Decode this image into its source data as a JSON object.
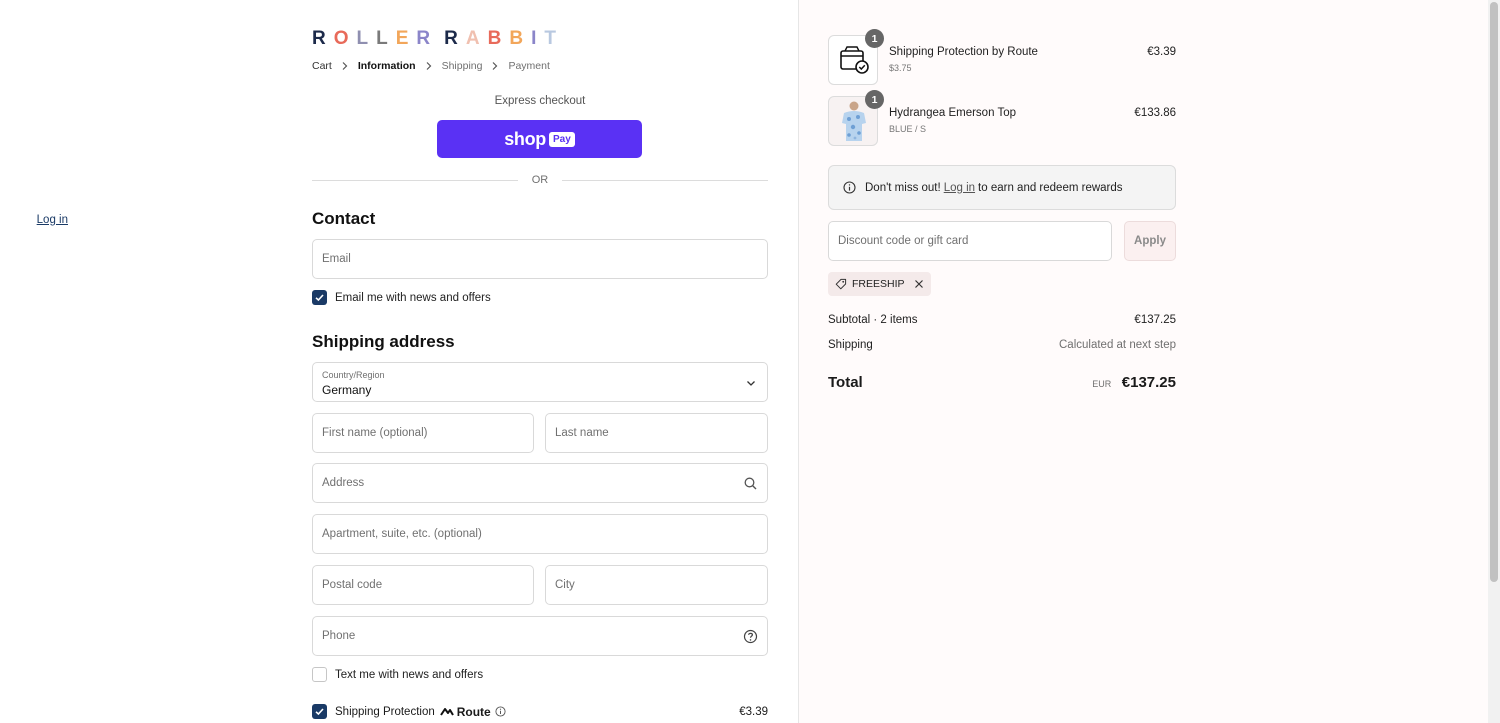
{
  "brand": {
    "logo_letters": [
      {
        "ch": "R",
        "color": "#1c2a4a"
      },
      {
        "ch": "O",
        "color": "#e86a5a"
      },
      {
        "ch": "L",
        "color": "#8f8fb0"
      },
      {
        "ch": "L",
        "color": "#7a7a7a"
      },
      {
        "ch": "E",
        "color": "#f2a65a"
      },
      {
        "ch": "R",
        "color": "#8b85c9"
      },
      {
        "ch": "R",
        "color": "#1c2a4a"
      },
      {
        "ch": "A",
        "color": "#f0c0b0"
      },
      {
        "ch": "B",
        "color": "#e86a5a"
      },
      {
        "ch": "B",
        "color": "#f2a65a"
      },
      {
        "ch": "I",
        "color": "#8b85c9"
      },
      {
        "ch": "T",
        "color": "#b8c8e0"
      }
    ]
  },
  "breadcrumb": {
    "cart": "Cart",
    "information": "Information",
    "shipping": "Shipping",
    "payment": "Payment"
  },
  "express": {
    "label": "Express checkout",
    "shop_label": "shop",
    "pay_label": "Pay",
    "or": "OR"
  },
  "contact": {
    "heading": "Contact",
    "login": "Log in",
    "email_placeholder": "Email",
    "email_news": "Email me with news and offers"
  },
  "shipping": {
    "heading": "Shipping address",
    "country_label": "Country/Region",
    "country_value": "Germany",
    "first_name_placeholder": "First name (optional)",
    "last_name_placeholder": "Last name",
    "address_placeholder": "Address",
    "apartment_placeholder": "Apartment, suite, etc. (optional)",
    "postal_placeholder": "Postal code",
    "city_placeholder": "City",
    "phone_placeholder": "Phone",
    "text_news": "Text me with news and offers",
    "protection_label": "Shipping Protection",
    "route_label": "Route",
    "protection_price": "€3.39"
  },
  "order": {
    "items": [
      {
        "name": "Shipping Protection by Route",
        "sub": "$3.75",
        "price": "€3.39",
        "qty": "1"
      },
      {
        "name": "Hydrangea Emerson Top",
        "sub": "BLUE / S",
        "price": "€133.86",
        "qty": "1"
      }
    ],
    "rewards": {
      "prefix": "Don't miss out!",
      "link": "Log in",
      "suffix": "to earn and redeem rewards"
    },
    "discount_placeholder": "Discount code or gift card",
    "apply": "Apply",
    "tag": "FREESHIP",
    "subtotal_label": "Subtotal · 2 items",
    "subtotal_value": "€137.25",
    "shipping_label": "Shipping",
    "shipping_value": "Calculated at next step",
    "total_label": "Total",
    "total_currency": "EUR",
    "total_value": "€137.25"
  },
  "colors": {
    "accent": "#1a3a66",
    "shoppay": "#5a31f4"
  }
}
